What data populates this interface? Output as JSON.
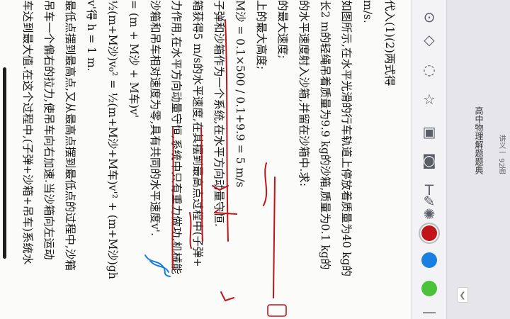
{
  "document": {
    "lines": [
      "代入(1)(2)两式得",
      "  m/s.",
      "如图所示,在水平光滑的行车轨道上停放着质量为40 kg的",
      "长2 m的轻绳吊着质量为9.9 kg的沙箱,质量为0.1 kg的",
      "的水平速度射入沙箱,并留在沙箱中.求:",
      "的最大速度;",
      "上的最大高度;",
      "M沙 = 0.1×500 / 0.1+9.9 = 5 m/s",
      "子弹和沙箱作为一个系统,在水平方向动量守恒.",
      "箱获得5 m/s的水平速度,在其摆到最高点过程中(子弹+",
      "力作用,在水平方向动量守恒,系统中只有重力做功,机械能",
      "沙箱和吊车相对速度为零,具有共同的水平速度v'.",
      "= (m + M沙 + M车)v'",
      "½(m+M沙)v₀² = ½(m+M沙+M车)v'² + (m+M沙)gh",
      "v'得   h = 1 m.",
      "最低点摆到最高点,又从最高点摆到最低点的过程中,沙箱",
      "吊车一个偏右的拉力,使吊车向右加速.当沙箱向左运动",
      "车达到最大值.在这个过程中,(子弹+沙箱+吊车)系统水"
    ]
  },
  "toolbar": {
    "tools": [
      "lasso-tool",
      "shapes-tool",
      "loop-tool",
      "star-tool",
      "image-tool",
      "camera-tool",
      "text-tool",
      "highlighter-tool",
      "laser-tool"
    ],
    "colors": [
      "#c0141b",
      "#1a7fe0",
      "#4cc23a"
    ],
    "selected_color": "#c0141b"
  },
  "header": {
    "title": "高中物理解题题典",
    "page_label": "讲义一 92面"
  }
}
